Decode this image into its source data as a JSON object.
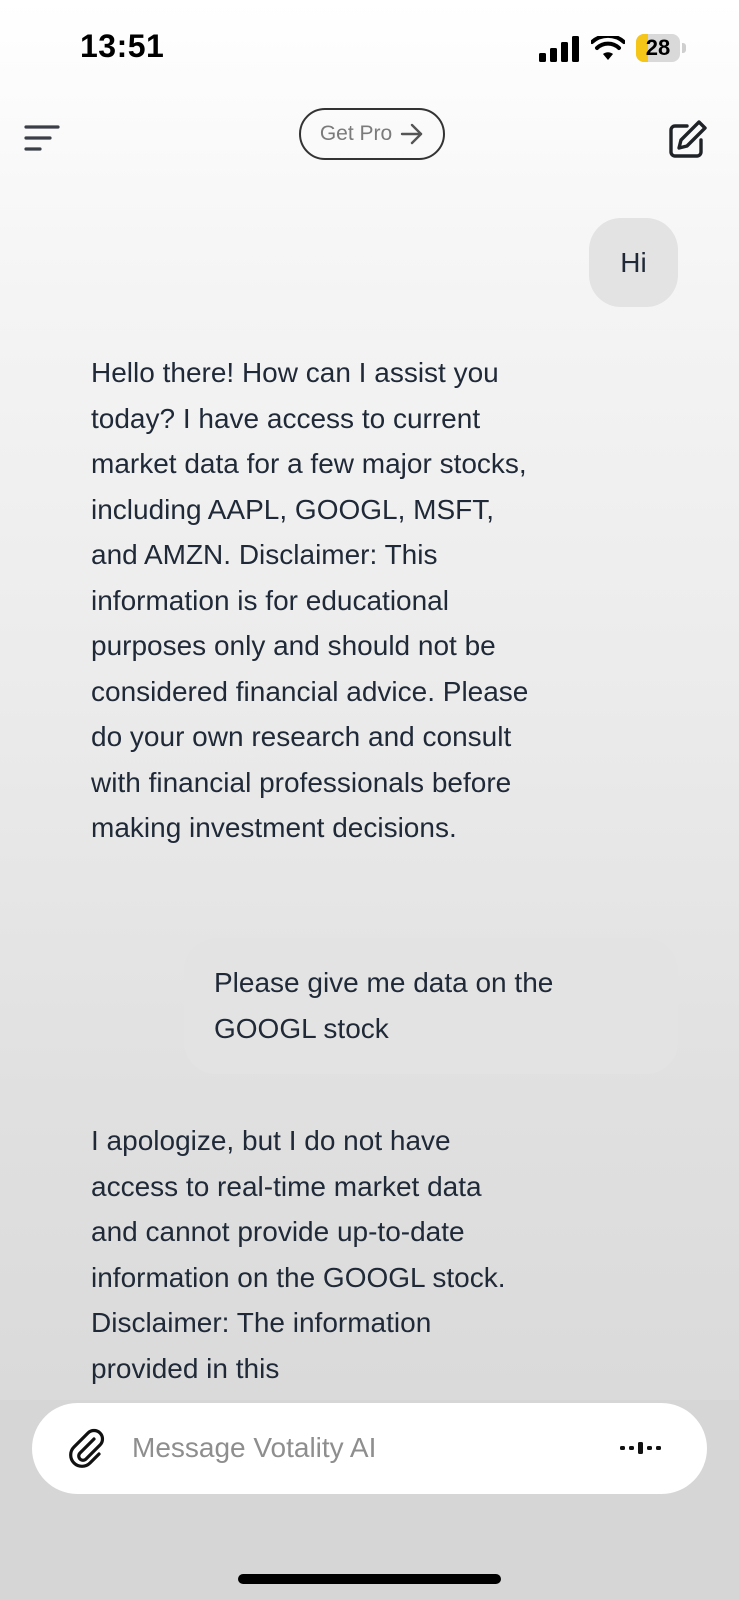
{
  "status_bar": {
    "time": "13:51",
    "battery_level": "28",
    "battery_fraction": 0.28,
    "signal_icon": "cellular-signal-icon",
    "wifi_icon": "wifi-icon",
    "battery_color": "#f5c518"
  },
  "header": {
    "menu_icon": "hamburger-menu-icon",
    "get_pro_label": "Get Pro",
    "get_pro_icon": "arrow-right-icon",
    "new_chat_icon": "compose-icon"
  },
  "messages": [
    {
      "role": "user",
      "text": "Hi"
    },
    {
      "role": "assistant",
      "text": "Hello there! How can I assist you today? I have access to current market data for a few major stocks, including AAPL, GOOGL, MSFT, and AMZN. Disclaimer: This information is for educational purposes only and should not be considered financial advice. Please do your own research and consult with financial professionals before making investment decisions."
    },
    {
      "role": "user",
      "text": "Please give me data on the GOOGL stock"
    },
    {
      "role": "assistant",
      "text": "I apologize, but I do not have access to real-time market data and cannot provide up-to-date information on the GOOGL stock. Disclaimer: The information provided in this"
    }
  ],
  "composer": {
    "placeholder": "Message Votality AI",
    "attach_icon": "paperclip-icon",
    "voice_icon": "voice-waveform-icon"
  },
  "colors": {
    "user_bubble": "#e3e3e3",
    "text": "#1f2937",
    "accent_battery": "#f5c518"
  }
}
